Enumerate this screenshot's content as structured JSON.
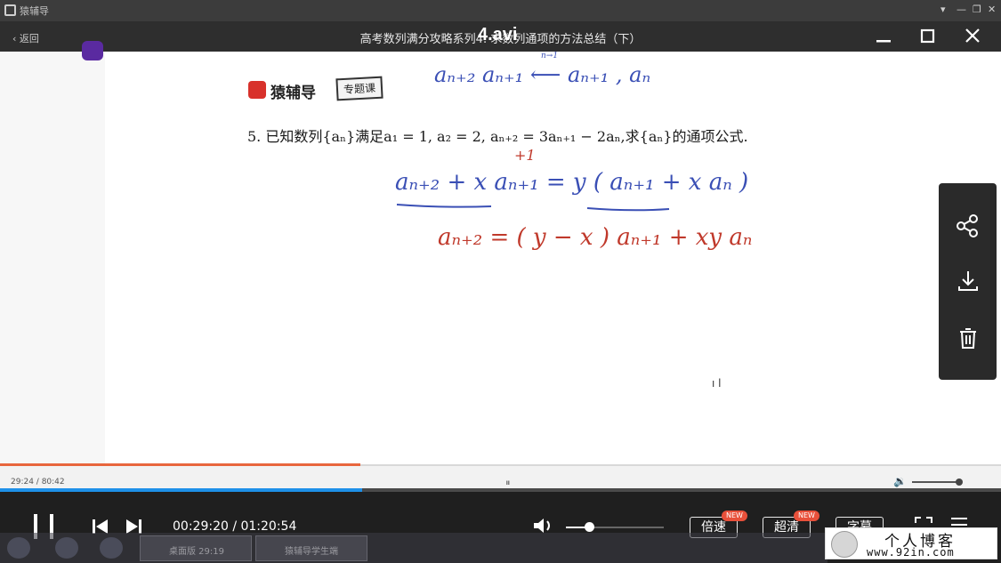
{
  "outer_window": {
    "title": "猿辅导",
    "controls": [
      "▾",
      "—",
      "❐",
      "✕"
    ]
  },
  "header": {
    "back_label": "返回",
    "title": "高考数列满分攻略系列4: 求数列通项的方法总结（下）",
    "overlay_text": "4.avi",
    "minimize_icon": "minimize-icon",
    "maximize_icon": "maximize-icon",
    "close_icon": "close-icon"
  },
  "lesson": {
    "brand": "猿辅导",
    "badge": "专题课",
    "problem": "5. 已知数列{aₙ}满足a₁ = 1, a₂ = 2, aₙ₊₂ = 3aₙ₊₁ − 2aₙ,求{aₙ}的通项公式.",
    "handwriting": {
      "top_note": "aₙ₊₂  aₙ₊₁  ⟵  aₙ₊₁ , aₙ",
      "top_note_small": "n→1",
      "eq1": "aₙ₊₂ + x aₙ₊₁ = y ( aₙ₊₁ + x aₙ )",
      "eq2": "aₙ₊₂ = ( y − x ) aₙ₊₁ + xy aₙ",
      "red_mark": "+1",
      "dot_mark": "ı l"
    }
  },
  "side_panel": {
    "share_icon": "share-icon",
    "download_icon": "download-icon",
    "delete_icon": "trash-icon"
  },
  "mini_player": {
    "time": "29:24 / 80:42",
    "pause_glyph": "⏸",
    "volume_glyph": "🔉"
  },
  "controls": {
    "current_time": "00:29:20",
    "duration": "01:20:54",
    "time_display": "00:29:20 / 01:20:54",
    "progress_fraction": 0.362,
    "volume_fraction": 0.24,
    "speed_label": "倍速",
    "quality_label": "超清",
    "subtitle_label": "字幕",
    "new_badge": "NEW"
  },
  "taskbar": {
    "items": [
      "桌面版 29:19",
      "猿辅导学生端"
    ]
  },
  "watermark": {
    "title": "个人博客",
    "url": "www.92in.com"
  },
  "colors": {
    "progress": "#1e90e8",
    "accent_orange": "#e8663d",
    "badge_red": "#e8503a",
    "handwriting_blue": "#3a4fb5",
    "handwriting_red": "#c0392b"
  }
}
